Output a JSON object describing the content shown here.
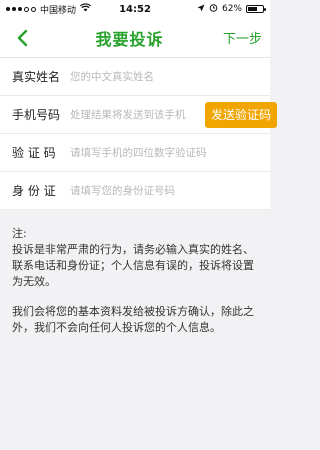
{
  "status_bar": {
    "carrier": "中国移动",
    "time": "14:52",
    "battery_percent": "62%",
    "battery_level": 0.62,
    "icons": [
      "signal-dots-icon",
      "wifi-icon",
      "location-arrow-icon",
      "alarm-icon",
      "battery-icon"
    ]
  },
  "nav": {
    "title": "我要投诉",
    "next_label": "下一步",
    "accent_color": "#26a22b"
  },
  "form": {
    "name": {
      "label": "真实姓名",
      "placeholder": "您的中文真实姓名"
    },
    "phone": {
      "label": "手机号码",
      "placeholder": "处理结果将发送到该手机",
      "send_code_label": "发送验证码"
    },
    "code": {
      "label": "验 证 码",
      "placeholder": "请填写手机的四位数字验证码"
    },
    "id_card": {
      "label": "身 份 证",
      "placeholder": "请填写您的身份证号码"
    }
  },
  "notes": {
    "title": "注:",
    "paragraph1": "投诉是非常严肃的行为，请务必输入真实的姓名、联系电话和身份证；个人信息有误的，投诉将设置为无效。",
    "paragraph2": "我们会将您的基本资料发给被投诉方确认，除此之外，我们不会向任何人投诉您的个人信息。"
  },
  "colors": {
    "button": "#f0a500",
    "background": "#f2f2f4"
  }
}
